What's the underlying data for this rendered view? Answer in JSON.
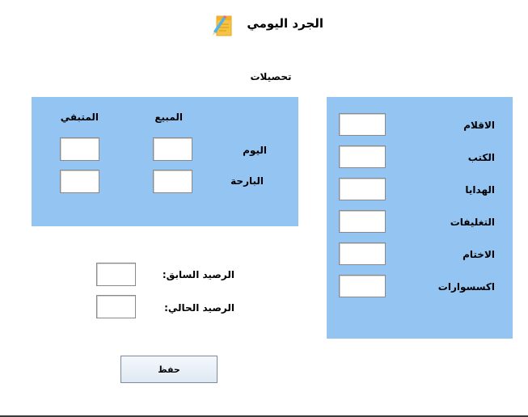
{
  "window": {
    "title": "الجرد اليومي",
    "title_icon": "notepad-pencil-icon"
  },
  "collections": {
    "title": "تحصيلات",
    "columns": {
      "sold": "المبيع",
      "remaining": "المتبقي"
    },
    "rows": {
      "today": "اليوم",
      "yesterday": "البارحة"
    },
    "values": {
      "today_sold": "",
      "today_remaining": "",
      "yesterday_sold": "",
      "yesterday_remaining": ""
    }
  },
  "categories": {
    "items": [
      {
        "label": "الاقلام",
        "value": ""
      },
      {
        "label": "الكتب",
        "value": ""
      },
      {
        "label": "الهدايا",
        "value": ""
      },
      {
        "label": "التغليفات",
        "value": ""
      },
      {
        "label": "الاختام",
        "value": ""
      },
      {
        "label": "اكسسوارات",
        "value": ""
      }
    ]
  },
  "balance": {
    "previous_label": "الرصيد السابق:",
    "previous_value": "",
    "current_label": "الرصيد الحالي:",
    "current_value": ""
  },
  "actions": {
    "save_label": "حفظ"
  },
  "colors": {
    "panel": "#94c4f2",
    "background": "#ffffff"
  }
}
